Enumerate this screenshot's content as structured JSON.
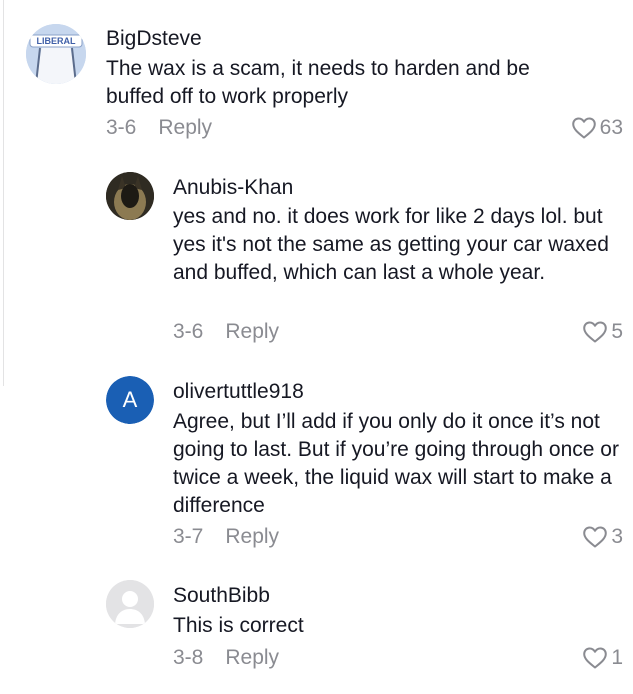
{
  "comments": [
    {
      "username": "BigDsteve",
      "text": "The wax is a scam, it needs to harden and be buffed off to work properly",
      "date": "3-6",
      "reply_label": "Reply",
      "likes": "63",
      "avatar_badge": "LIBERAL"
    },
    {
      "username": "Anubis-Khan",
      "text": "yes and no. it does work for like 2 days lol. but yes it's not the same as getting your car waxed and buffed, which can last a whole year.",
      "date": "3-6",
      "reply_label": "Reply",
      "likes": "5"
    },
    {
      "username": "olivertuttle918",
      "text": "Agree, but I’ll add if you only do it once it’s not going to last. But if you’re going through once or twice a week, the liquid wax will start to make a difference",
      "date": "3-7",
      "reply_label": "Reply",
      "likes": "3",
      "avatar_letter": "A",
      "avatar_color": "#1a5fb4"
    },
    {
      "username": "SouthBibb",
      "text": "This is correct",
      "date": "3-8",
      "reply_label": "Reply",
      "likes": "1"
    }
  ],
  "colors": {
    "text": "#161823",
    "muted": "#8a8b91",
    "divider": "#e3e3e4"
  }
}
